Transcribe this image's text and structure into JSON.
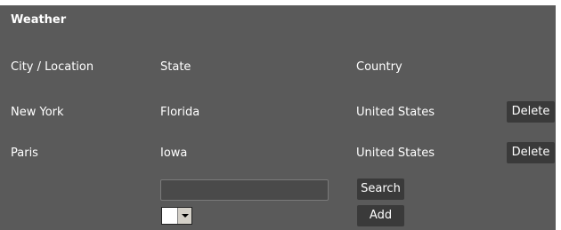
{
  "section": {
    "title": "Weather"
  },
  "table": {
    "headers": [
      "City / Location",
      "State",
      "Country"
    ],
    "rows": [
      {
        "city": "New York",
        "state": "Florida",
        "country": "United States",
        "action": "Delete"
      },
      {
        "city": "Paris",
        "state": "Iowa",
        "country": "United States",
        "action": "Delete"
      }
    ]
  },
  "search": {
    "input_value": "",
    "search_label": "Search",
    "add_label": "Add",
    "select_value": ""
  },
  "colors": {
    "panel": "#5a5a5a",
    "button": "#3a3a3a",
    "text": "#ffffff"
  }
}
